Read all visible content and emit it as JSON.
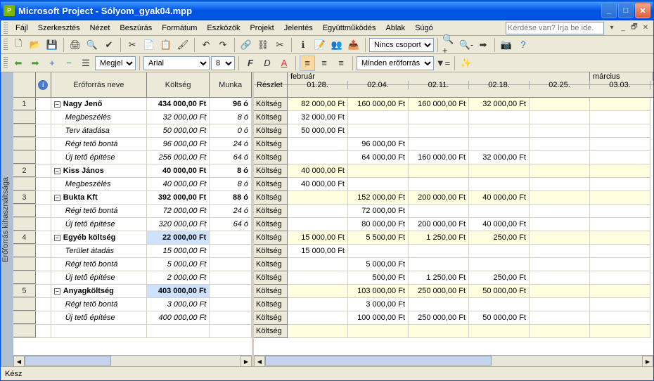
{
  "title": "Microsoft Project - Sólyom_gyak04.mpp",
  "menu": {
    "file": "Fájl",
    "edit": "Szerkesztés",
    "view": "Nézet",
    "insert": "Beszúrás",
    "format": "Formátum",
    "tools": "Eszközök",
    "project": "Projekt",
    "report": "Jelentés",
    "collab": "Együttműködés",
    "window": "Ablak",
    "help": "Súgó"
  },
  "help_placeholder": "Kérdése van? Írja be ide.",
  "toolbar2": {
    "view_label": "Megjelenítés",
    "font": "Arial",
    "size": "8",
    "group": "Nincs csoportosítá",
    "filter": "Minden erőforrás"
  },
  "left_headers": {
    "name": "Erőforrás neve",
    "cost": "Költség",
    "work": "Munka"
  },
  "right_headers": {
    "detail": "Részlet",
    "feb": "február",
    "mar": "március",
    "d1": "01.28.",
    "d2": "02.04.",
    "d3": "02.11.",
    "d4": "02.18.",
    "d5": "02.25.",
    "d6": "03.03."
  },
  "det": "Költség",
  "rows": [
    {
      "n": "1",
      "name": "Nagy Jenő",
      "cost": "434 000,00 Ft",
      "work": "96 ó",
      "bold": true,
      "outline": true
    },
    {
      "name": "Megbeszélés",
      "cost": "32 000,00 Ft",
      "work": "8 ó",
      "italic": true
    },
    {
      "name": "Terv átadása",
      "cost": "50 000,00 Ft",
      "work": "0 ó",
      "italic": true
    },
    {
      "name": "Régi tető bontá",
      "cost": "96 000,00 Ft",
      "work": "24 ó",
      "italic": true
    },
    {
      "name": "Új tető építése",
      "cost": "256 000,00 Ft",
      "work": "64 ó",
      "italic": true
    },
    {
      "n": "2",
      "name": "Kiss János",
      "cost": "40 000,00 Ft",
      "work": "8 ó",
      "bold": true,
      "outline": true
    },
    {
      "name": "Megbeszélés",
      "cost": "40 000,00 Ft",
      "work": "8 ó",
      "italic": true
    },
    {
      "n": "3",
      "name": "Bukta Kft",
      "cost": "392 000,00 Ft",
      "work": "88 ó",
      "bold": true,
      "outline": true
    },
    {
      "name": "Régi tető bontá",
      "cost": "72 000,00 Ft",
      "work": "24 ó",
      "italic": true
    },
    {
      "name": "Új tető építése",
      "cost": "320 000,00 Ft",
      "work": "64 ó",
      "italic": true
    },
    {
      "n": "4",
      "name": "Egyéb költség",
      "cost": "22 000,00 Ft",
      "work": "",
      "bold": true,
      "outline": true,
      "sel": true
    },
    {
      "name": "Terület átadás",
      "cost": "15 000,00 Ft",
      "work": "",
      "italic": true
    },
    {
      "name": "Régi tető bontá",
      "cost": "5 000,00 Ft",
      "work": "",
      "italic": true
    },
    {
      "name": "Új tető építése",
      "cost": "2 000,00 Ft",
      "work": "",
      "italic": true
    },
    {
      "n": "5",
      "name": "Anyagköltség",
      "cost": "403 000,00 Ft",
      "work": "",
      "bold": true,
      "outline": true,
      "sel": true
    },
    {
      "name": "Régi tető bontá",
      "cost": "3 000,00 Ft",
      "work": "",
      "italic": true
    },
    {
      "name": "Új tető építése",
      "cost": "400 000,00 Ft",
      "work": "",
      "italic": true
    },
    {
      "name": "",
      "cost": "",
      "work": ""
    }
  ],
  "timedata": [
    {
      "y": true,
      "c": [
        "82 000,00 Ft",
        "160 000,00 Ft",
        "160 000,00 Ft",
        "32 000,00 Ft",
        "",
        ""
      ]
    },
    {
      "c": [
        "32 000,00 Ft",
        "",
        "",
        "",
        "",
        ""
      ]
    },
    {
      "c": [
        "50 000,00 Ft",
        "",
        "",
        "",
        "",
        ""
      ]
    },
    {
      "c": [
        "",
        "96 000,00 Ft",
        "",
        "",
        "",
        ""
      ]
    },
    {
      "c": [
        "",
        "64 000,00 Ft",
        "160 000,00 Ft",
        "32 000,00 Ft",
        "",
        ""
      ]
    },
    {
      "y": true,
      "c": [
        "40 000,00 Ft",
        "",
        "",
        "",
        "",
        ""
      ]
    },
    {
      "c": [
        "40 000,00 Ft",
        "",
        "",
        "",
        "",
        ""
      ]
    },
    {
      "y": true,
      "c": [
        "",
        "152 000,00 Ft",
        "200 000,00 Ft",
        "40 000,00 Ft",
        "",
        ""
      ]
    },
    {
      "c": [
        "",
        "72 000,00 Ft",
        "",
        "",
        "",
        ""
      ]
    },
    {
      "c": [
        "",
        "80 000,00 Ft",
        "200 000,00 Ft",
        "40 000,00 Ft",
        "",
        ""
      ]
    },
    {
      "y": true,
      "c": [
        "15 000,00 Ft",
        "5 500,00 Ft",
        "1 250,00 Ft",
        "250,00 Ft",
        "",
        ""
      ]
    },
    {
      "c": [
        "15 000,00 Ft",
        "",
        "",
        "",
        "",
        ""
      ]
    },
    {
      "c": [
        "",
        "5 000,00 Ft",
        "",
        "",
        "",
        ""
      ]
    },
    {
      "c": [
        "",
        "500,00 Ft",
        "1 250,00 Ft",
        "250,00 Ft",
        "",
        ""
      ]
    },
    {
      "y": true,
      "c": [
        "",
        "103 000,00 Ft",
        "250 000,00 Ft",
        "50 000,00 Ft",
        "",
        ""
      ]
    },
    {
      "c": [
        "",
        "3 000,00 Ft",
        "",
        "",
        "",
        ""
      ]
    },
    {
      "c": [
        "",
        "100 000,00 Ft",
        "250 000,00 Ft",
        "50 000,00 Ft",
        "",
        ""
      ]
    },
    {
      "y": true,
      "c": [
        "",
        "",
        "",
        "",
        "",
        ""
      ]
    }
  ],
  "sidebar": "Erőforrás kihasználtsága",
  "status": "Kész"
}
